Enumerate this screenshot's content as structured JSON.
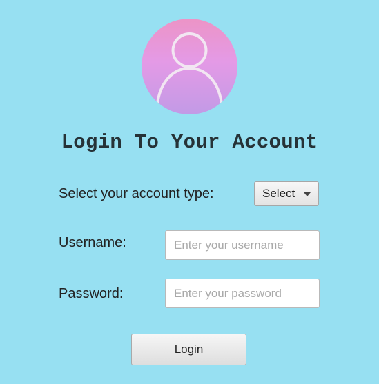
{
  "avatar": {
    "icon": "user-avatar-icon",
    "gradient": [
      "#ec94c6",
      "#e49ae6",
      "#c29ae6"
    ],
    "stroke": "#f2e6f2"
  },
  "colors": {
    "background": "#97e0f2",
    "title": "#263237"
  },
  "title": "Login To Your Account",
  "account_type": {
    "label": "Select your account type:",
    "selected": "Select",
    "icon": "dropdown-caret-icon"
  },
  "username": {
    "label": "Username:",
    "value": "",
    "placeholder": "Enter your username"
  },
  "password": {
    "label": "Password:",
    "value": "",
    "placeholder": "Enter your password"
  },
  "login_button": "Login"
}
